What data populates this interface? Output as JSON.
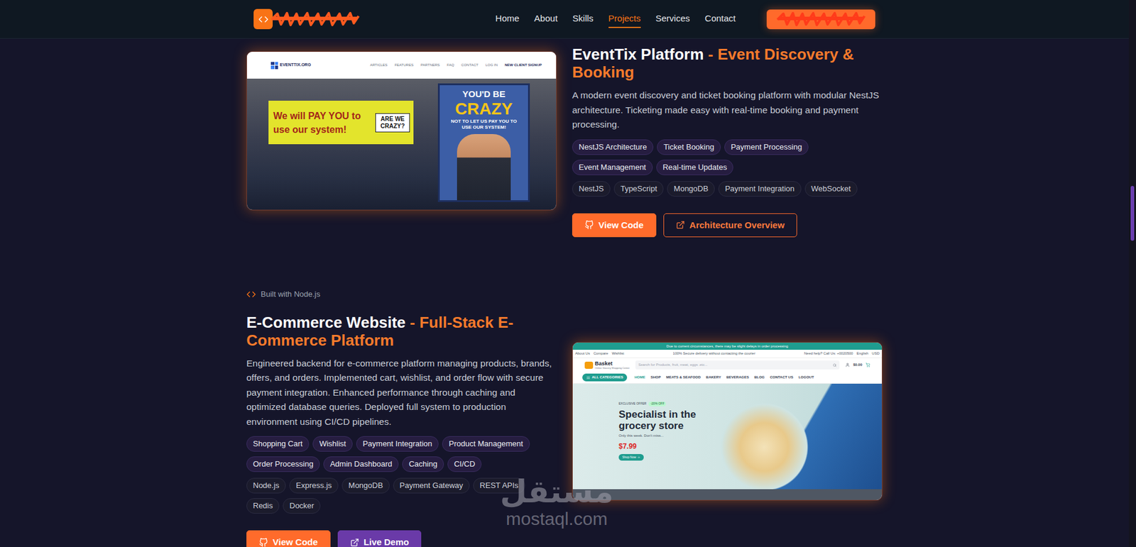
{
  "header": {
    "logo": {
      "redacted": true
    },
    "nav": [
      {
        "label": "Home",
        "selected": false
      },
      {
        "label": "About",
        "selected": false
      },
      {
        "label": "Skills",
        "selected": false
      },
      {
        "label": "Projects",
        "selected": true
      },
      {
        "label": "Services",
        "selected": false
      },
      {
        "label": "Contact",
        "selected": false
      }
    ],
    "cta": {
      "redacted": true
    }
  },
  "projects": [
    {
      "kind": "left",
      "title": "EventTix Platform",
      "subtitle": "- Event Discovery & Booking",
      "description": "A modern event discovery and ticket booking platform with modular NestJS architecture. Ticketing made easy with real-time booking and payment processing.",
      "features": [
        "NestJS Architecture",
        "Ticket Booking",
        "Payment Processing",
        "Event Management",
        "Real-time Updates"
      ],
      "tech": [
        "NestJS",
        "TypeScript",
        "MongoDB",
        "Payment Integration",
        "WebSocket"
      ],
      "buttons": [
        {
          "label": "View Code",
          "kind": "primary"
        },
        {
          "label": "Architecture Overview",
          "kind": "outline"
        }
      ],
      "preview": {
        "kind": "eventtix",
        "logo": "EVENTTIX.ORG",
        "nav": [
          "ARTICLES",
          "FEATURES",
          "PARTNERS",
          "FAQ",
          "CONTACT",
          "LOG IN"
        ],
        "cta": "NEW CLIENT SIGNUP",
        "banner": {
          "text": "We will PAY YOU to use our system!",
          "aside": "ARE WE CRAZY?"
        },
        "poster": {
          "top": "YOU'D BE",
          "headline": "CRAZY",
          "bottom": "NOT TO LET US PAY YOU TO USE OUR SYSTEM!"
        }
      }
    },
    {
      "kind": "right",
      "badge": "Built with Node.js",
      "title": "E-Commerce Website",
      "subtitle": "- Full-Stack E-Commerce Platform",
      "description": "Engineered backend for e-commerce platform managing products, brands, offers, and orders. Implemented cart, wishlist, and order flow with secure payment integration. Enhanced performance through caching and optimized database queries. Deployed full system to production environment using CI/CD pipelines.",
      "features": [
        "Shopping Cart",
        "Wishlist",
        "Payment Integration",
        "Product Management",
        "Order Processing",
        "Admin Dashboard",
        "Caching",
        "CI/CD"
      ],
      "tech": [
        "Node.js",
        "Express.js",
        "MongoDB",
        "Payment Gateway",
        "REST APIs",
        "Redis",
        "Docker"
      ],
      "buttons": [
        {
          "label": "View Code",
          "kind": "primary"
        },
        {
          "label": "Live Demo",
          "kind": "secondary"
        }
      ],
      "preview": {
        "kind": "grocery",
        "notice": "Due to current circumstances, there may be slight delays in order processing",
        "links": [
          "About Us",
          "Compare",
          "Wishlist"
        ],
        "promise": "100% Secure delivery without contacting the courier",
        "help": "Need help? Call Us: +0020500",
        "locale": [
          "English",
          "USD"
        ],
        "logo": "Basket",
        "tagline": "Online Grocery Shopping Center",
        "search": {
          "placeholder": "Search for Products, fruit, meat, eggs .etc..."
        },
        "cart": "$0.00",
        "categories": "ALL CATEGORIES",
        "nav": [
          {
            "label": "HOME",
            "selected": true
          },
          {
            "label": "SHOP",
            "selected": false
          },
          {
            "label": "MEATS & SEAFOOD",
            "selected": false
          },
          {
            "label": "BAKERY",
            "selected": false
          },
          {
            "label": "BEVERAGES",
            "selected": false
          },
          {
            "label": "BLOG",
            "selected": false
          },
          {
            "label": "CONTACT US",
            "selected": false
          },
          {
            "label": "LOGOUT",
            "selected": false
          }
        ],
        "hero": {
          "eyebrow": "EXCLUSIVE OFFER",
          "badge": "-20% OFF",
          "title": "Specialist in the grocery store",
          "subtitle": "Only this week. Don't miss...",
          "price": "$7.99",
          "button": "Shop Now"
        }
      }
    }
  ],
  "watermark": {
    "script": "مستقل",
    "url": "mostaql.com"
  },
  "scrollbar": {
    "level": 0.34
  }
}
